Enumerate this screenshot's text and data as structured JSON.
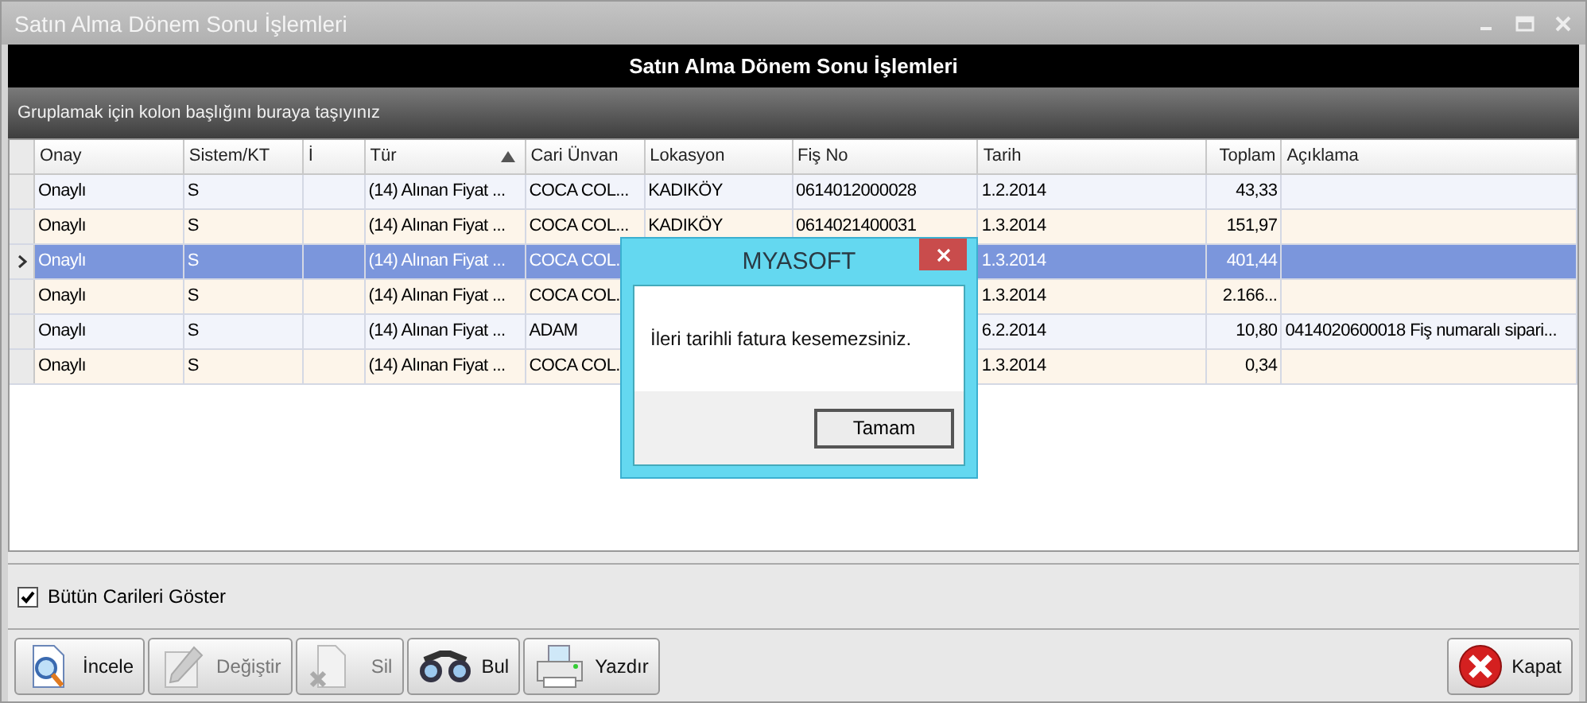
{
  "window": {
    "title": "Satın Alma Dönem Sonu İşlemleri"
  },
  "header": {
    "title": "Satın Alma Dönem Sonu İşlemleri"
  },
  "group_panel": {
    "hint": "Gruplamak için kolon başlığını buraya taşıyınız"
  },
  "table": {
    "columns": [
      {
        "label": "Onay",
        "sorted": false
      },
      {
        "label": "Sistem/KT",
        "sorted": false
      },
      {
        "label": "İ",
        "sorted": false
      },
      {
        "label": "Tür",
        "sorted": true
      },
      {
        "label": "Cari Ünvan",
        "sorted": false
      },
      {
        "label": "Lokasyon",
        "sorted": false
      },
      {
        "label": "Fiş No",
        "sorted": false
      },
      {
        "label": "Tarih",
        "sorted": false
      },
      {
        "label": "Toplam",
        "sorted": false
      },
      {
        "label": "Açıklama",
        "sorted": false
      }
    ],
    "rows": [
      {
        "selected": false,
        "cells": [
          "Onaylı",
          "S",
          "",
          "(14) Alınan Fiyat ...",
          "COCA COL...",
          "KADIKÖY",
          "0614012000028",
          "1.2.2014",
          "43,33",
          ""
        ]
      },
      {
        "selected": false,
        "cells": [
          "Onaylı",
          "S",
          "",
          "(14) Alınan Fiyat ...",
          "COCA COL...",
          "KADIKÖY",
          "0614021400031",
          "1.3.2014",
          "151,97",
          ""
        ]
      },
      {
        "selected": true,
        "cells": [
          "Onaylı",
          "S",
          "",
          "(14) Alınan Fiyat ...",
          "COCA COL.",
          "",
          "",
          "1.3.2014",
          "401,44",
          ""
        ]
      },
      {
        "selected": false,
        "cells": [
          "Onaylı",
          "S",
          "",
          "(14) Alınan Fiyat ...",
          "COCA COL.",
          "",
          "",
          "1.3.2014",
          "2.166...",
          ""
        ]
      },
      {
        "selected": false,
        "cells": [
          "Onaylı",
          "S",
          "",
          "(14) Alınan Fiyat ...",
          "ADAM",
          "",
          "",
          "6.2.2014",
          "10,80",
          "0414020600018 Fiş numaralı sipari..."
        ]
      },
      {
        "selected": false,
        "cells": [
          "Onaylı",
          "S",
          "",
          "(14) Alınan Fiyat ...",
          "COCA COL.",
          "",
          "",
          "1.3.2014",
          "0,34",
          ""
        ]
      }
    ]
  },
  "options": {
    "show_all": {
      "label": "Bütün Carileri Göster",
      "checked": true
    }
  },
  "toolbar": [
    {
      "kind": "view",
      "label": "İncele",
      "disabled": false
    },
    {
      "kind": "edit",
      "label": "Değiştir",
      "disabled": true
    },
    {
      "kind": "delete",
      "label": "Sil",
      "disabled": true
    },
    {
      "kind": "find",
      "label": "Bul",
      "disabled": false
    },
    {
      "kind": "print",
      "label": "Yazdır",
      "disabled": false
    }
  ],
  "close_button": {
    "label": "Kapat"
  },
  "dialog": {
    "title": "MYASOFT",
    "message": "İleri tarihli fatura kesemezsiniz.",
    "button": "Tamam"
  }
}
